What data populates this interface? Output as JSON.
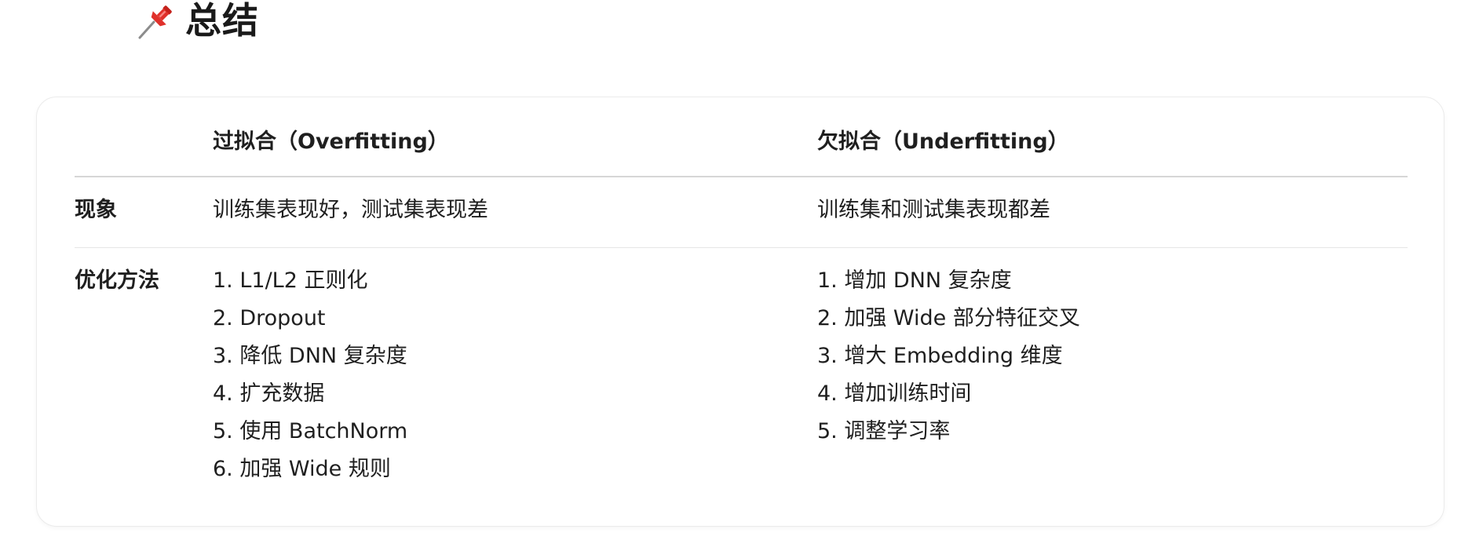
{
  "heading": {
    "icon": "pushpin-icon",
    "title": "总结"
  },
  "table": {
    "headers": [
      "",
      "过拟合（Overfitting）",
      "欠拟合（Underfitting）"
    ],
    "rows": [
      {
        "label": "现象",
        "overfitting": "训练集表现好，测试集表现差",
        "underfitting": "训练集和测试集表现都差"
      },
      {
        "label": "优化方法",
        "overfitting": [
          "1. L1/L2 正则化",
          "2. Dropout",
          "3. 降低 DNN 复杂度",
          "4. 扩充数据",
          "5. 使用 BatchNorm",
          "6. 加强 Wide 规则"
        ],
        "underfitting": [
          "1. 增加 DNN 复杂度",
          "2. 加强 Wide 部分特征交叉",
          "3. 增大 Embedding 维度",
          "4. 增加训练时间",
          "5. 调整学习率"
        ]
      }
    ]
  },
  "colors": {
    "pin_red": "#e0312b",
    "pin_needle": "#8c8c8c",
    "text": "#1f1f1f",
    "border": "#d6d6d6"
  }
}
